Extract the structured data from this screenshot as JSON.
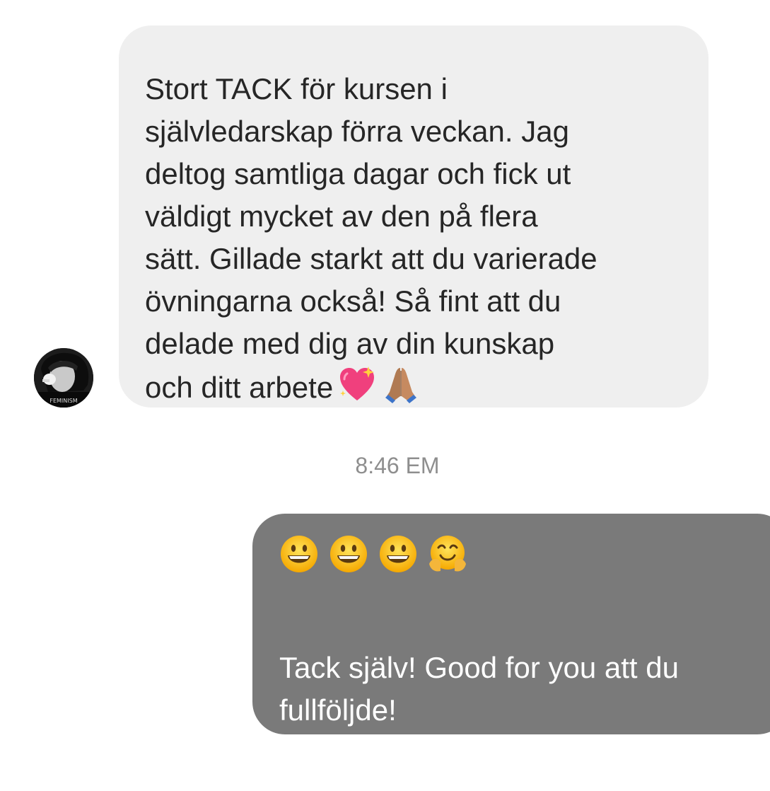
{
  "conversation": {
    "incoming_message": {
      "lines": [
        "Stort TACK för kursen i",
        "självledarskap förra veckan. Jag",
        "deltog samtliga dagar och fick ut",
        "väldigt mycket av den på flera",
        "sätt. Gillade starkt att du varierade",
        "övningarna också! Så fint att du",
        "delade med dig av din kunskap",
        "och ditt arbete"
      ],
      "trailing_emojis": [
        "sparkling-heart",
        "folded-hands"
      ],
      "avatar_text": "FEMINISM"
    },
    "timestamp": "8:46 EM",
    "outgoing_message": {
      "emojis": [
        "grinning-face",
        "grinning-face",
        "grinning-face",
        "hugging-face"
      ],
      "lines": [
        "Tack själv! Good for you att du",
        "fullföljde!"
      ]
    }
  },
  "colors": {
    "incoming_bubble": "#efefef",
    "outgoing_bubble": "#7a7a7a",
    "timestamp": "#8e8e8e"
  }
}
